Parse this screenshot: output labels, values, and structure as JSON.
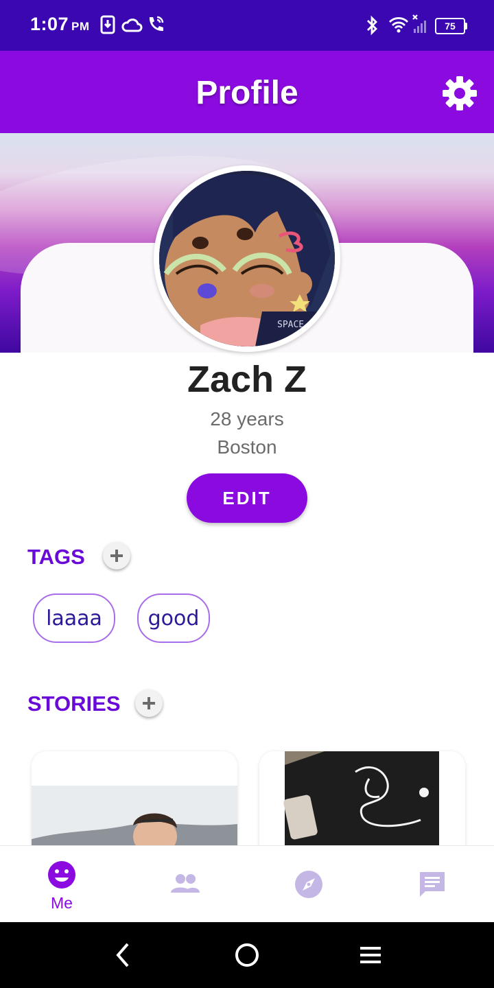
{
  "status_bar": {
    "time": "1:07",
    "ampm": "PM",
    "battery": "75"
  },
  "app_bar": {
    "title": "Profile",
    "settings_icon": "gear-icon"
  },
  "profile": {
    "name": "Zach Z",
    "age": "28 years",
    "city": "Boston",
    "edit_label": "EDIT",
    "avatar_text": "SPACE NOVELTY"
  },
  "tags_section": {
    "title": "TAGS",
    "add_icon": "plus-icon",
    "tags": [
      {
        "label": "laaaa"
      },
      {
        "label": "good"
      }
    ]
  },
  "stories_section": {
    "title": "STORIES",
    "add_icon": "plus-icon"
  },
  "bottom_nav": {
    "items": [
      {
        "label": "Me",
        "icon": "smiley-icon",
        "active": true
      },
      {
        "label": "",
        "icon": "people-icon",
        "active": false
      },
      {
        "label": "",
        "icon": "compass-icon",
        "active": false
      },
      {
        "label": "",
        "icon": "chat-icon",
        "active": false
      }
    ]
  },
  "colors": {
    "status_bar": "#3a07b0",
    "app_bar": "#8a0ae0",
    "accent_text": "#6a0ad8",
    "inactive_nav": "#c4b7e6"
  }
}
